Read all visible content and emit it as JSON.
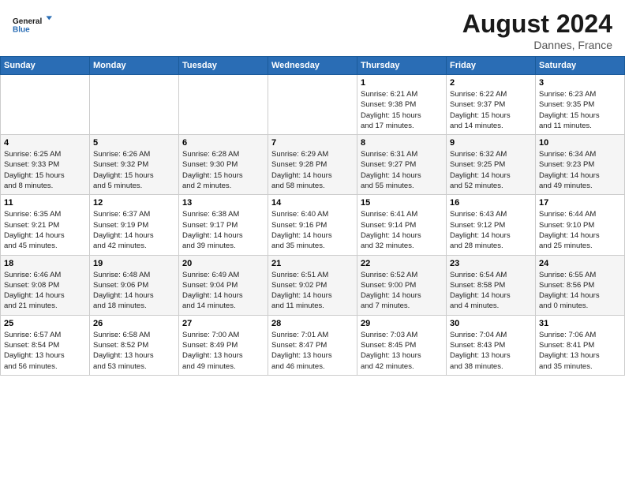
{
  "header": {
    "logo_line1": "General",
    "logo_line2": "Blue",
    "month_year": "August 2024",
    "location": "Dannes, France"
  },
  "calendar": {
    "days_of_week": [
      "Sunday",
      "Monday",
      "Tuesday",
      "Wednesday",
      "Thursday",
      "Friday",
      "Saturday"
    ],
    "weeks": [
      [
        {
          "num": "",
          "info": ""
        },
        {
          "num": "",
          "info": ""
        },
        {
          "num": "",
          "info": ""
        },
        {
          "num": "",
          "info": ""
        },
        {
          "num": "1",
          "info": "Sunrise: 6:21 AM\nSunset: 9:38 PM\nDaylight: 15 hours\nand 17 minutes."
        },
        {
          "num": "2",
          "info": "Sunrise: 6:22 AM\nSunset: 9:37 PM\nDaylight: 15 hours\nand 14 minutes."
        },
        {
          "num": "3",
          "info": "Sunrise: 6:23 AM\nSunset: 9:35 PM\nDaylight: 15 hours\nand 11 minutes."
        }
      ],
      [
        {
          "num": "4",
          "info": "Sunrise: 6:25 AM\nSunset: 9:33 PM\nDaylight: 15 hours\nand 8 minutes."
        },
        {
          "num": "5",
          "info": "Sunrise: 6:26 AM\nSunset: 9:32 PM\nDaylight: 15 hours\nand 5 minutes."
        },
        {
          "num": "6",
          "info": "Sunrise: 6:28 AM\nSunset: 9:30 PM\nDaylight: 15 hours\nand 2 minutes."
        },
        {
          "num": "7",
          "info": "Sunrise: 6:29 AM\nSunset: 9:28 PM\nDaylight: 14 hours\nand 58 minutes."
        },
        {
          "num": "8",
          "info": "Sunrise: 6:31 AM\nSunset: 9:27 PM\nDaylight: 14 hours\nand 55 minutes."
        },
        {
          "num": "9",
          "info": "Sunrise: 6:32 AM\nSunset: 9:25 PM\nDaylight: 14 hours\nand 52 minutes."
        },
        {
          "num": "10",
          "info": "Sunrise: 6:34 AM\nSunset: 9:23 PM\nDaylight: 14 hours\nand 49 minutes."
        }
      ],
      [
        {
          "num": "11",
          "info": "Sunrise: 6:35 AM\nSunset: 9:21 PM\nDaylight: 14 hours\nand 45 minutes."
        },
        {
          "num": "12",
          "info": "Sunrise: 6:37 AM\nSunset: 9:19 PM\nDaylight: 14 hours\nand 42 minutes."
        },
        {
          "num": "13",
          "info": "Sunrise: 6:38 AM\nSunset: 9:17 PM\nDaylight: 14 hours\nand 39 minutes."
        },
        {
          "num": "14",
          "info": "Sunrise: 6:40 AM\nSunset: 9:16 PM\nDaylight: 14 hours\nand 35 minutes."
        },
        {
          "num": "15",
          "info": "Sunrise: 6:41 AM\nSunset: 9:14 PM\nDaylight: 14 hours\nand 32 minutes."
        },
        {
          "num": "16",
          "info": "Sunrise: 6:43 AM\nSunset: 9:12 PM\nDaylight: 14 hours\nand 28 minutes."
        },
        {
          "num": "17",
          "info": "Sunrise: 6:44 AM\nSunset: 9:10 PM\nDaylight: 14 hours\nand 25 minutes."
        }
      ],
      [
        {
          "num": "18",
          "info": "Sunrise: 6:46 AM\nSunset: 9:08 PM\nDaylight: 14 hours\nand 21 minutes."
        },
        {
          "num": "19",
          "info": "Sunrise: 6:48 AM\nSunset: 9:06 PM\nDaylight: 14 hours\nand 18 minutes."
        },
        {
          "num": "20",
          "info": "Sunrise: 6:49 AM\nSunset: 9:04 PM\nDaylight: 14 hours\nand 14 minutes."
        },
        {
          "num": "21",
          "info": "Sunrise: 6:51 AM\nSunset: 9:02 PM\nDaylight: 14 hours\nand 11 minutes."
        },
        {
          "num": "22",
          "info": "Sunrise: 6:52 AM\nSunset: 9:00 PM\nDaylight: 14 hours\nand 7 minutes."
        },
        {
          "num": "23",
          "info": "Sunrise: 6:54 AM\nSunset: 8:58 PM\nDaylight: 14 hours\nand 4 minutes."
        },
        {
          "num": "24",
          "info": "Sunrise: 6:55 AM\nSunset: 8:56 PM\nDaylight: 14 hours\nand 0 minutes."
        }
      ],
      [
        {
          "num": "25",
          "info": "Sunrise: 6:57 AM\nSunset: 8:54 PM\nDaylight: 13 hours\nand 56 minutes."
        },
        {
          "num": "26",
          "info": "Sunrise: 6:58 AM\nSunset: 8:52 PM\nDaylight: 13 hours\nand 53 minutes."
        },
        {
          "num": "27",
          "info": "Sunrise: 7:00 AM\nSunset: 8:49 PM\nDaylight: 13 hours\nand 49 minutes."
        },
        {
          "num": "28",
          "info": "Sunrise: 7:01 AM\nSunset: 8:47 PM\nDaylight: 13 hours\nand 46 minutes."
        },
        {
          "num": "29",
          "info": "Sunrise: 7:03 AM\nSunset: 8:45 PM\nDaylight: 13 hours\nand 42 minutes."
        },
        {
          "num": "30",
          "info": "Sunrise: 7:04 AM\nSunset: 8:43 PM\nDaylight: 13 hours\nand 38 minutes."
        },
        {
          "num": "31",
          "info": "Sunrise: 7:06 AM\nSunset: 8:41 PM\nDaylight: 13 hours\nand 35 minutes."
        }
      ]
    ]
  }
}
